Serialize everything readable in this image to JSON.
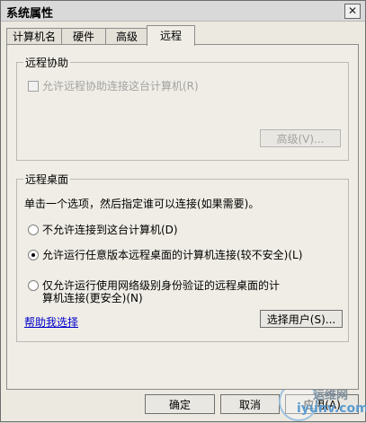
{
  "window": {
    "title": "系统属性"
  },
  "tabs": [
    {
      "label": "计算机名"
    },
    {
      "label": "硬件"
    },
    {
      "label": "高级"
    },
    {
      "label": "远程"
    }
  ],
  "remote_assistance": {
    "title": "远程协助",
    "checkbox_label": "允许远程协助连接这台计算机(R)",
    "advanced_button": "高级(V)..."
  },
  "remote_desktop": {
    "title": "远程桌面",
    "instruction": "单击一个选项，然后指定谁可以连接(如果需要)。",
    "options": [
      {
        "label": "不允许连接到这台计算机(D)"
      },
      {
        "label": "允许运行任意版本远程桌面的计算机连接(较不安全)(L)"
      },
      {
        "label_line1": "仅允许运行使用网络级别身份验证的远程桌面的计",
        "label_line2": "算机连接(更安全)(N)"
      }
    ],
    "selected_index": 1,
    "help_link": "帮助我选择",
    "select_users_button": "选择用户(S)..."
  },
  "footer": {
    "ok": "确定",
    "cancel": "取消",
    "apply": "应用(A)"
  },
  "watermark": {
    "cn": "运维网",
    "en": "iyunv.com"
  }
}
